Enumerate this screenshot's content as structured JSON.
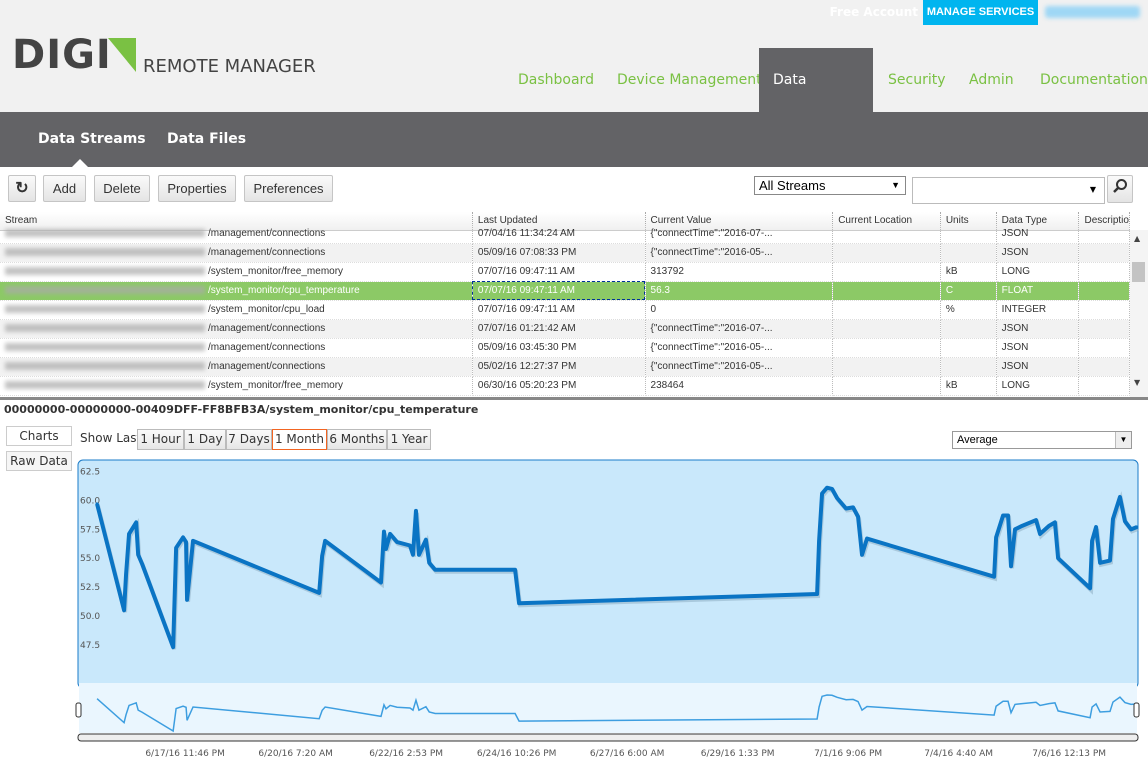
{
  "header": {
    "free_account": "Free Account",
    "manage_services": "MANAGE SERVICES",
    "logo_text": "DIGI",
    "product": "REMOTE MANAGER",
    "nav": [
      "Dashboard",
      "Device Management",
      "Data Services",
      "Security",
      "Admin",
      "Documentation"
    ],
    "active_nav": "Data Services"
  },
  "subnav": {
    "items": [
      "Data Streams",
      "Data Files"
    ],
    "active": "Data Streams"
  },
  "toolbar": {
    "refresh_icon": "refresh-icon",
    "add": "Add",
    "delete": "Delete",
    "properties": "Properties",
    "preferences": "Preferences",
    "filter": "All Streams",
    "search_value": "",
    "search_icon": "search-icon"
  },
  "grid": {
    "columns": [
      "Stream",
      "Last Updated",
      "Current Value",
      "Current Location",
      "Units",
      "Data Type",
      "Descriptio"
    ],
    "rows": [
      {
        "stream": "/management/connections",
        "updated": "07/04/16 11:34:24 AM",
        "value": "{\"connectTime\":\"2016-07-...",
        "location": "",
        "units": "",
        "type": "JSON"
      },
      {
        "stream": "/management/connections",
        "updated": "05/09/16 07:08:33 PM",
        "value": "{\"connectTime\":\"2016-05-...",
        "location": "",
        "units": "",
        "type": "JSON"
      },
      {
        "stream": "/system_monitor/free_memory",
        "updated": "07/07/16 09:47:11 AM",
        "value": "313792",
        "location": "",
        "units": "kB",
        "type": "LONG"
      },
      {
        "stream": "/system_monitor/cpu_temperature",
        "updated": "07/07/16 09:47:11 AM",
        "value": "56.3",
        "location": "",
        "units": "C",
        "type": "FLOAT",
        "selected": true
      },
      {
        "stream": "/system_monitor/cpu_load",
        "updated": "07/07/16 09:47:11 AM",
        "value": "0",
        "location": "",
        "units": "%",
        "type": "INTEGER"
      },
      {
        "stream": "/management/connections",
        "updated": "07/07/16 01:21:42 AM",
        "value": "{\"connectTime\":\"2016-07-...",
        "location": "",
        "units": "",
        "type": "JSON"
      },
      {
        "stream": "/management/connections",
        "updated": "05/09/16 03:45:30 PM",
        "value": "{\"connectTime\":\"2016-05-...",
        "location": "",
        "units": "",
        "type": "JSON"
      },
      {
        "stream": "/management/connections",
        "updated": "05/02/16 12:27:37 PM",
        "value": "{\"connectTime\":\"2016-05-...",
        "location": "",
        "units": "",
        "type": "JSON"
      },
      {
        "stream": "/system_monitor/free_memory",
        "updated": "06/30/16 05:20:23 PM",
        "value": "238464",
        "location": "",
        "units": "kB",
        "type": "LONG"
      }
    ]
  },
  "detail": {
    "stream_path": "00000000-00000000-00409DFF-FF8BFB3A/system_monitor/cpu_temperature",
    "tabs": [
      "Charts",
      "Raw Data"
    ],
    "active_tab": "Charts",
    "show_last_label": "Show Last:",
    "ranges": [
      "1 Hour",
      "1 Day",
      "7 Days",
      "1 Month",
      "6 Months",
      "1 Year"
    ],
    "active_range": "1 Month",
    "aggregate": "Average"
  },
  "colors": {
    "brand_green": "#7ac143",
    "accent_blue": "#00b5ef",
    "line": "#0a74c4",
    "plot_bg": "#c9e8fb",
    "selected_row": "#8cc966",
    "active_range_border": "#f26522"
  },
  "chart_data": {
    "type": "line",
    "title": "",
    "xlabel": "",
    "ylabel": "",
    "xlim": [
      "2016-06-15T17:55",
      "2016-07-07T22:50"
    ],
    "ylim": [
      44.2,
      63.5
    ],
    "yticks": [
      47.5,
      50.0,
      52.5,
      55.0,
      57.5,
      60.0,
      62.5
    ],
    "xticks": [
      [
        "2016-06-17T23:46",
        "6/17/16 11:46 PM"
      ],
      [
        "2016-06-20T07:20",
        "6/20/16 7:20 AM"
      ],
      [
        "2016-06-22T14:53",
        "6/22/16 2:53 PM"
      ],
      [
        "2016-06-24T22:26",
        "6/24/16 10:26 PM"
      ],
      [
        "2016-06-27T06:00",
        "6/27/16 6:00 AM"
      ],
      [
        "2016-06-29T13:33",
        "6/29/16 1:33 PM"
      ],
      [
        "2016-07-01T21:06",
        "7/1/16 9:06 PM"
      ],
      [
        "2016-07-04T04:40",
        "7/4/16 4:40 AM"
      ],
      [
        "2016-07-06T12:13",
        "7/6/16 12:13 PM"
      ]
    ],
    "grid": false,
    "legend": "none",
    "navigator": true,
    "points": [
      [
        "2016-06-16T03:30",
        59.7
      ],
      [
        "2016-06-16T17:05",
        50.5
      ],
      [
        "2016-06-16T18:05",
        53.6
      ],
      [
        "2016-06-16T19:35",
        57.1
      ],
      [
        "2016-06-16T23:10",
        58.1
      ],
      [
        "2016-06-17T00:10",
        55.3
      ],
      [
        "2016-06-17T02:10",
        54.5
      ],
      [
        "2016-06-17T17:45",
        47.3
      ],
      [
        "2016-06-17T19:15",
        55.9
      ],
      [
        "2016-06-17T22:45",
        56.8
      ],
      [
        "2016-06-18T00:15",
        56.4
      ],
      [
        "2016-06-18T00:45",
        51.4
      ],
      [
        "2016-06-18T03:45",
        56.5
      ],
      [
        "2016-06-20T19:10",
        52.0
      ],
      [
        "2016-06-20T20:40",
        55.2
      ],
      [
        "2016-06-20T22:10",
        56.5
      ],
      [
        "2016-06-22T02:15",
        52.9
      ],
      [
        "2016-06-22T03:45",
        57.3
      ],
      [
        "2016-06-22T04:45",
        55.8
      ],
      [
        "2016-06-22T06:50",
        57.1
      ],
      [
        "2016-06-22T10:20",
        56.4
      ],
      [
        "2016-06-22T16:50",
        56.1
      ],
      [
        "2016-06-22T18:20",
        55.3
      ],
      [
        "2016-06-22T19:50",
        59.1
      ],
      [
        "2016-06-22T21:20",
        55.3
      ],
      [
        "2016-06-23T00:50",
        56.6
      ],
      [
        "2016-06-23T02:30",
        54.6
      ],
      [
        "2016-06-23T05:30",
        54.0
      ],
      [
        "2016-06-24T21:40",
        54.0
      ],
      [
        "2016-06-24T23:40",
        51.1
      ],
      [
        "2016-07-01T05:30",
        51.9
      ],
      [
        "2016-07-01T06:30",
        56.5
      ],
      [
        "2016-07-01T08:00",
        60.6
      ],
      [
        "2016-07-01T10:30",
        61.1
      ],
      [
        "2016-07-01T13:00",
        61.0
      ],
      [
        "2016-07-01T15:35",
        60.2
      ],
      [
        "2016-07-01T20:05",
        59.3
      ],
      [
        "2016-07-01T23:35",
        59.4
      ],
      [
        "2016-07-02T02:05",
        58.6
      ],
      [
        "2016-07-02T04:05",
        55.3
      ],
      [
        "2016-07-02T06:35",
        56.7
      ],
      [
        "2016-07-04T22:30",
        53.4
      ],
      [
        "2016-07-04T23:30",
        56.8
      ],
      [
        "2016-07-05T03:00",
        58.7
      ],
      [
        "2016-07-05T05:30",
        58.7
      ],
      [
        "2016-07-05T07:00",
        54.3
      ],
      [
        "2016-07-05T09:00",
        57.5
      ],
      [
        "2016-07-05T12:35",
        57.8
      ],
      [
        "2016-07-05T19:35",
        58.3
      ],
      [
        "2016-07-05T21:35",
        57.1
      ],
      [
        "2016-07-06T02:05",
        57.8
      ],
      [
        "2016-07-06T05:05",
        58.1
      ],
      [
        "2016-07-06T06:40",
        55.0
      ],
      [
        "2016-07-06T22:45",
        52.4
      ],
      [
        "2016-07-06T23:45",
        56.5
      ],
      [
        "2016-07-07T01:45",
        57.7
      ],
      [
        "2016-07-07T03:46",
        54.6
      ],
      [
        "2016-07-07T08:45",
        54.8
      ],
      [
        "2016-07-07T10:15",
        58.4
      ],
      [
        "2016-07-07T13:46",
        60.3
      ],
      [
        "2016-07-07T16:16",
        58.2
      ],
      [
        "2016-07-07T19:20",
        57.5
      ],
      [
        "2016-07-07T22:20",
        57.7
      ]
    ]
  }
}
